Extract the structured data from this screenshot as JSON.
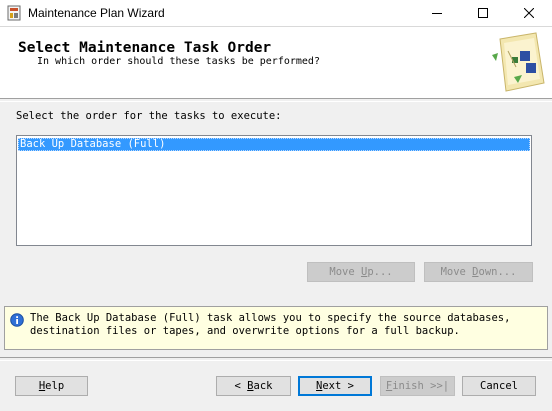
{
  "window": {
    "title": "Maintenance Plan Wizard"
  },
  "header": {
    "title": "Select Maintenance Task Order",
    "subtitle": "In which order should these tasks be performed?"
  },
  "instruction": "Select the order for the tasks to execute:",
  "tasks": [
    {
      "label": "Back Up Database (Full)",
      "selected": true
    }
  ],
  "order_buttons": {
    "move_up": {
      "pre": "Move ",
      "key": "U",
      "post": "p...",
      "enabled": false
    },
    "move_down": {
      "pre": "Move ",
      "key": "D",
      "post": "own...",
      "enabled": false
    }
  },
  "info": {
    "text": "The Back Up Database (Full) task allows you to specify the source databases,\ndestination files or tapes, and overwrite options for a full backup."
  },
  "footer": {
    "help": {
      "pre": "",
      "key": "H",
      "post": "elp"
    },
    "back": {
      "pre": "< ",
      "key": "B",
      "post": "ack"
    },
    "next": {
      "pre": "",
      "key": "N",
      "post": "ext >"
    },
    "finish": {
      "pre": "",
      "key": "F",
      "post": "inish >>|",
      "enabled": false
    },
    "cancel": {
      "pre": "",
      "key": "",
      "post": "Cancel"
    }
  },
  "colors": {
    "selection": "#3399ff",
    "info_background": "#ffffe1",
    "default_button_border": "#0078d7"
  },
  "icons": [
    "app-icon",
    "minimize-icon",
    "maximize-icon",
    "close-icon",
    "wizard-graphic-icon",
    "info-icon"
  ]
}
